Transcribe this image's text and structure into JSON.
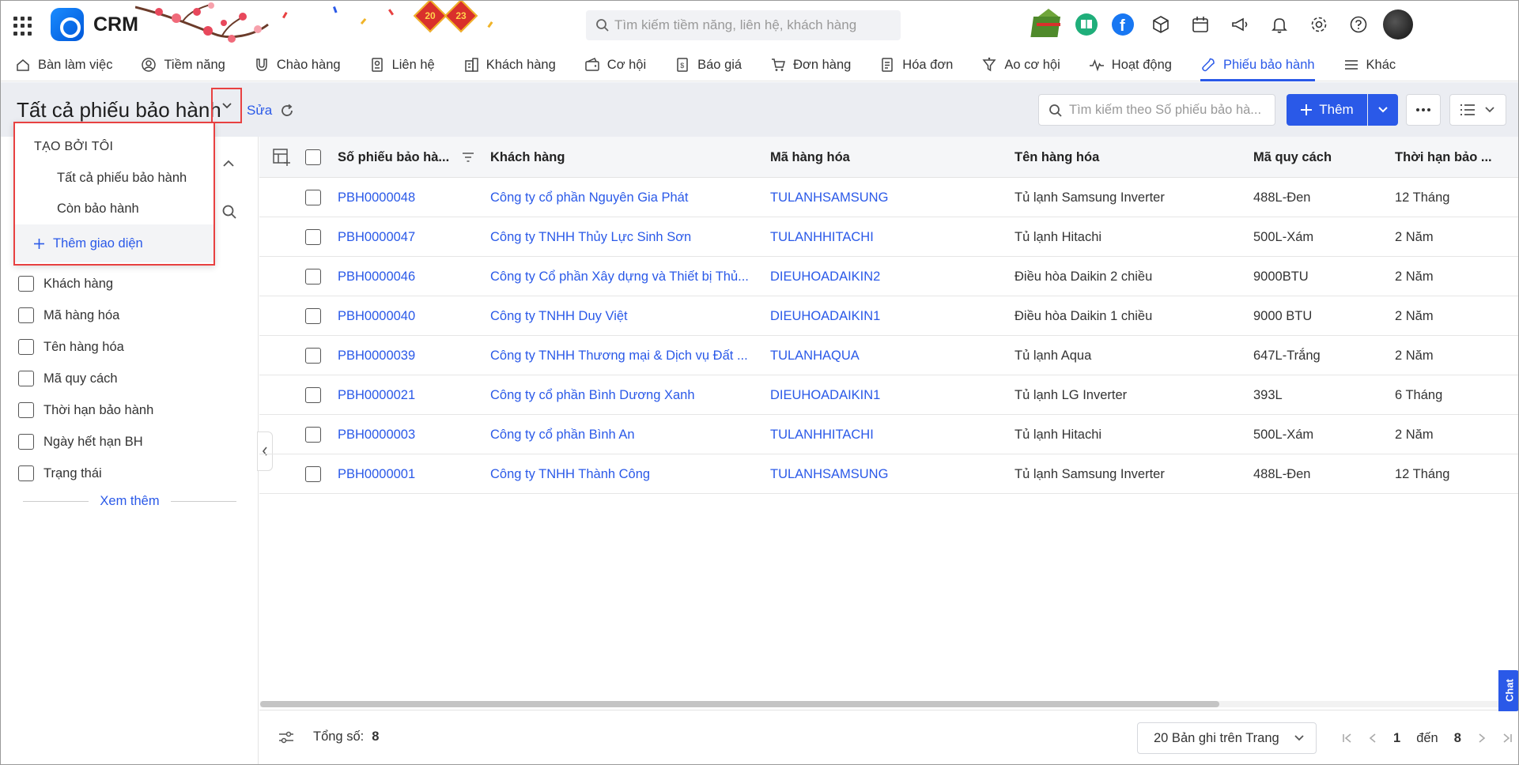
{
  "app": {
    "name": "CRM"
  },
  "decor": {
    "year_left": "20",
    "year_right": "23"
  },
  "global_search": {
    "placeholder": "Tìm kiếm tiềm năng, liên hệ, khách hàng"
  },
  "nav": {
    "items": [
      {
        "label": "Bàn làm việc",
        "icon": "home-icon"
      },
      {
        "label": "Tiềm năng",
        "icon": "user-circle-icon"
      },
      {
        "label": "Chào hàng",
        "icon": "magnet-icon"
      },
      {
        "label": "Liên hệ",
        "icon": "contact-card-icon"
      },
      {
        "label": "Khách hàng",
        "icon": "building-icon"
      },
      {
        "label": "Cơ hội",
        "icon": "wallet-icon"
      },
      {
        "label": "Báo giá",
        "icon": "quote-doc-icon"
      },
      {
        "label": "Đơn hàng",
        "icon": "cart-icon"
      },
      {
        "label": "Hóa đơn",
        "icon": "invoice-icon"
      },
      {
        "label": "Ao cơ hội",
        "icon": "funnel-icon"
      },
      {
        "label": "Hoạt động",
        "icon": "activity-icon"
      },
      {
        "label": "Phiếu bảo hành",
        "icon": "wrench-icon",
        "active": true
      },
      {
        "label": "Khác",
        "icon": "menu-icon"
      }
    ]
  },
  "view": {
    "title": "Tất cả phiếu bảo hành",
    "edit_label": "Sửa"
  },
  "toolbar": {
    "search_placeholder": "Tìm kiếm theo Số phiếu bảo hà...",
    "add_label": "Thêm"
  },
  "dropdown": {
    "group_label": "TẠO BỞI TÔI",
    "items": [
      "Tất cả phiếu bảo hành",
      "Còn bảo hành"
    ],
    "add_view_label": "Thêm giao diện"
  },
  "filters": {
    "items": [
      "Khách hàng",
      "Mã hàng hóa",
      "Tên hàng hóa",
      "Mã quy cách",
      "Thời hạn bảo hành",
      "Ngày hết hạn BH",
      "Trạng thái"
    ],
    "see_more_label": "Xem thêm"
  },
  "table": {
    "columns": [
      "Số phiếu bảo hà...",
      "Khách hàng",
      "Mã hàng hóa",
      "Tên hàng hóa",
      "Mã quy cách",
      "Thời hạn bảo ..."
    ],
    "rows": [
      [
        "PBH0000048",
        "Công ty cổ phần Nguyên Gia Phát",
        "TULANHSAMSUNG",
        "Tủ lạnh Samsung Inverter",
        "488L-Đen",
        "12 Tháng"
      ],
      [
        "PBH0000047",
        "Công ty TNHH Thủy Lực Sinh Sơn",
        "TULANHHITACHI",
        "Tủ lạnh Hitachi",
        "500L-Xám",
        "2 Năm"
      ],
      [
        "PBH0000046",
        "Công ty Cổ phần Xây dựng và Thiết bị Thủ...",
        "DIEUHOADAIKIN2",
        "Điều hòa Daikin 2 chiều",
        "9000BTU",
        "2 Năm"
      ],
      [
        "PBH0000040",
        "Công ty TNHH Duy Việt",
        "DIEUHOADAIKIN1",
        "Điều hòa Daikin 1 chiều",
        "9000 BTU",
        "2 Năm"
      ],
      [
        "PBH0000039",
        "Công ty TNHH Thương mại & Dịch vụ Đất ...",
        "TULANHAQUA",
        "Tủ lạnh Aqua",
        "647L-Trắng",
        "2 Năm"
      ],
      [
        "PBH0000021",
        "Công ty cổ phần Bình Dương Xanh",
        "DIEUHOADAIKIN1",
        "Tủ lạnh LG Inverter",
        "393L",
        "6 Tháng"
      ],
      [
        "PBH0000003",
        "Công ty cổ phần Bình An",
        "TULANHHITACHI",
        "Tủ lạnh Hitachi",
        "500L-Xám",
        "2 Năm"
      ],
      [
        "PBH0000001",
        "Công ty TNHH Thành Công",
        "TULANHSAMSUNG",
        "Tủ lạnh Samsung Inverter",
        "488L-Đen",
        "12 Tháng"
      ]
    ]
  },
  "footer": {
    "total_label": "Tổng số:",
    "total_value": "8",
    "page_size_label": "20 Bản ghi trên Trang",
    "page_from": "1",
    "page_to_label": "đến",
    "page_to": "8"
  },
  "chat": {
    "label": "Chat"
  },
  "colors": {
    "accent": "#2a59e8",
    "highlight": "#e84141",
    "subheader_bg": "#ebedf2"
  }
}
